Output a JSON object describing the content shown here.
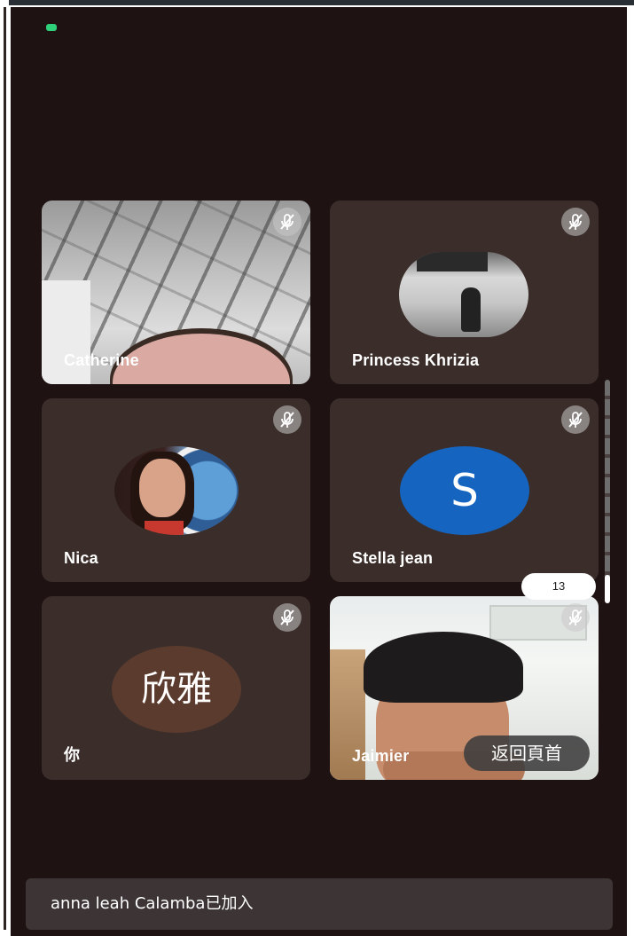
{
  "counter": {
    "label": "13"
  },
  "tiles": [
    {
      "name": "Catherine",
      "muted": true,
      "kind": "video",
      "icon": "mic-off-icon"
    },
    {
      "name": "Princess Khrizia",
      "muted": true,
      "kind": "photo-avatar",
      "icon": "mic-off-icon"
    },
    {
      "name": "Nica",
      "muted": true,
      "kind": "photo-avatar",
      "icon": "mic-off-icon"
    },
    {
      "name": "Stella jean",
      "muted": true,
      "kind": "letter-avatar",
      "avatar_letter": "S",
      "avatar_color": "#1565c0",
      "icon": "mic-off-icon"
    },
    {
      "name": "你",
      "muted": true,
      "kind": "text-avatar",
      "avatar_text": "欣雅",
      "avatar_color": "#5b3b2e",
      "icon": "mic-off-icon"
    },
    {
      "name": "Jaimier",
      "muted": true,
      "kind": "video",
      "icon": "mic-off-icon"
    }
  ],
  "back_button": {
    "label": "返回頁首"
  },
  "toast": {
    "text": "anna leah Calamba已加入"
  },
  "colors": {
    "background": "#1e1212",
    "tile": "#3b2e2a",
    "status_indicator": "#2fd07a"
  }
}
